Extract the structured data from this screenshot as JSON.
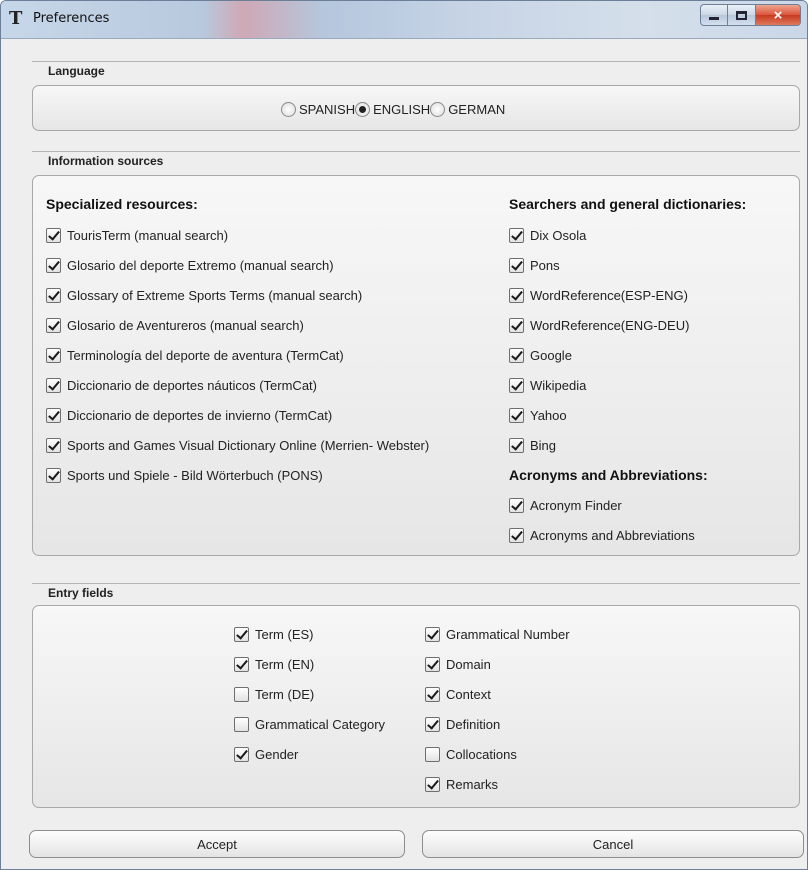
{
  "window": {
    "title": "Preferences",
    "app_icon_glyph": "T",
    "controls": {
      "minimize": "minimize-icon",
      "maximize": "maximize-icon",
      "close": "×"
    }
  },
  "language": {
    "title": "Language",
    "options": [
      {
        "label": "SPANISH",
        "selected": false
      },
      {
        "label": "ENGLISH",
        "selected": true
      },
      {
        "label": "GERMAN",
        "selected": false
      }
    ]
  },
  "sources": {
    "title": "Information sources",
    "specialized": {
      "heading": "Specialized resources:",
      "items": [
        {
          "label": "TourisTerm (manual search)",
          "checked": true
        },
        {
          "label": "Glosario del deporte Extremo (manual search)",
          "checked": true
        },
        {
          "label": "Glossary of Extreme Sports Terms (manual search)",
          "checked": true
        },
        {
          "label": "Glosario de Aventureros (manual search)",
          "checked": true
        },
        {
          "label": "Terminología del deporte de aventura (TermCat)",
          "checked": true
        },
        {
          "label": "Diccionario de deportes náuticos (TermCat)",
          "checked": true
        },
        {
          "label": "Diccionario de deportes de invierno (TermCat)",
          "checked": true
        },
        {
          "label": "Sports and Games Visual Dictionary Online (Merrien- Webster)",
          "checked": true
        },
        {
          "label": "Sports und Spiele - Bild Wörterbuch (PONS)",
          "checked": true
        }
      ]
    },
    "searchers": {
      "heading": "Searchers and general dictionaries:",
      "items": [
        {
          "label": "Dix Osola",
          "checked": true
        },
        {
          "label": "Pons",
          "checked": true
        },
        {
          "label": "WordReference(ESP-ENG)",
          "checked": true
        },
        {
          "label": "WordReference(ENG-DEU)",
          "checked": true
        },
        {
          "label": "Google",
          "checked": true
        },
        {
          "label": "Wikipedia",
          "checked": true
        },
        {
          "label": "Yahoo",
          "checked": true
        },
        {
          "label": "Bing",
          "checked": true
        }
      ]
    },
    "acronyms": {
      "heading": "Acronyms and Abbreviations:",
      "items": [
        {
          "label": "Acronym Finder",
          "checked": true
        },
        {
          "label": "Acronyms and Abbreviations",
          "checked": true
        }
      ]
    }
  },
  "entry_fields": {
    "title": "Entry fields",
    "left": [
      {
        "label": "Term (ES)",
        "checked": true
      },
      {
        "label": "Term (EN)",
        "checked": true
      },
      {
        "label": "Term (DE)",
        "checked": false
      },
      {
        "label": "Grammatical Category",
        "checked": false
      },
      {
        "label": "Gender",
        "checked": true
      }
    ],
    "right": [
      {
        "label": "Grammatical Number",
        "checked": true
      },
      {
        "label": "Domain",
        "checked": true
      },
      {
        "label": "Context",
        "checked": true
      },
      {
        "label": "Definition",
        "checked": true
      },
      {
        "label": "Collocations",
        "checked": false
      },
      {
        "label": "Remarks",
        "checked": true
      }
    ]
  },
  "buttons": {
    "accept": "Accept",
    "cancel": "Cancel"
  }
}
